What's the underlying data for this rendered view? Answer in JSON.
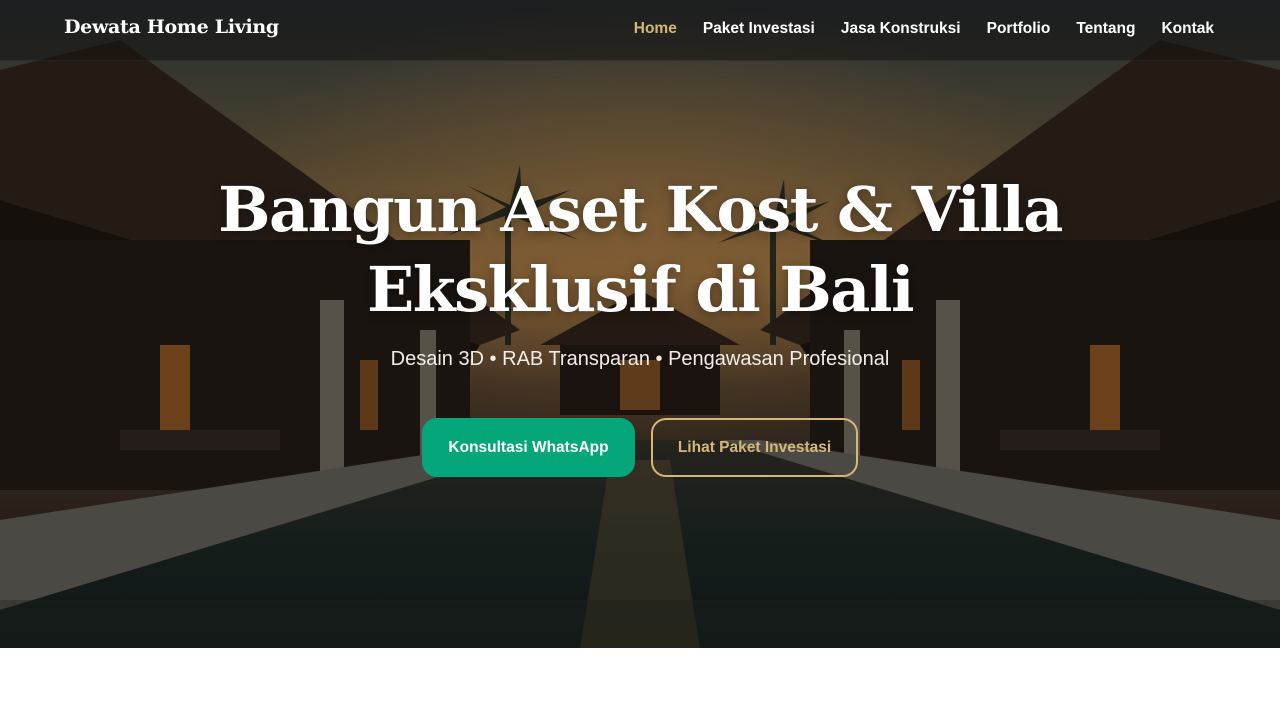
{
  "nav": {
    "brand": "Dewata Home Living",
    "links": [
      {
        "label": "Home",
        "active": true
      },
      {
        "label": "Paket Investasi",
        "active": false
      },
      {
        "label": "Jasa Konstruksi",
        "active": false
      },
      {
        "label": "Portfolio",
        "active": false
      },
      {
        "label": "Tentang",
        "active": false
      },
      {
        "label": "Kontak",
        "active": false
      }
    ]
  },
  "hero": {
    "title": "Bangun Aset Kost & Villa Eksklusif di Bali",
    "subtitle": "Desain 3D • RAB Transparan • Pengawasan Profesional",
    "background_image": "luxury-villa-pool-at-dusk",
    "primary_button": "Konsultasi WhatsApp",
    "secondary_button": "Lihat Paket Investasi"
  },
  "colors": {
    "accent_gold": "#d6b77a",
    "whatsapp_green": "#05a679",
    "text_white": "#ffffff"
  }
}
